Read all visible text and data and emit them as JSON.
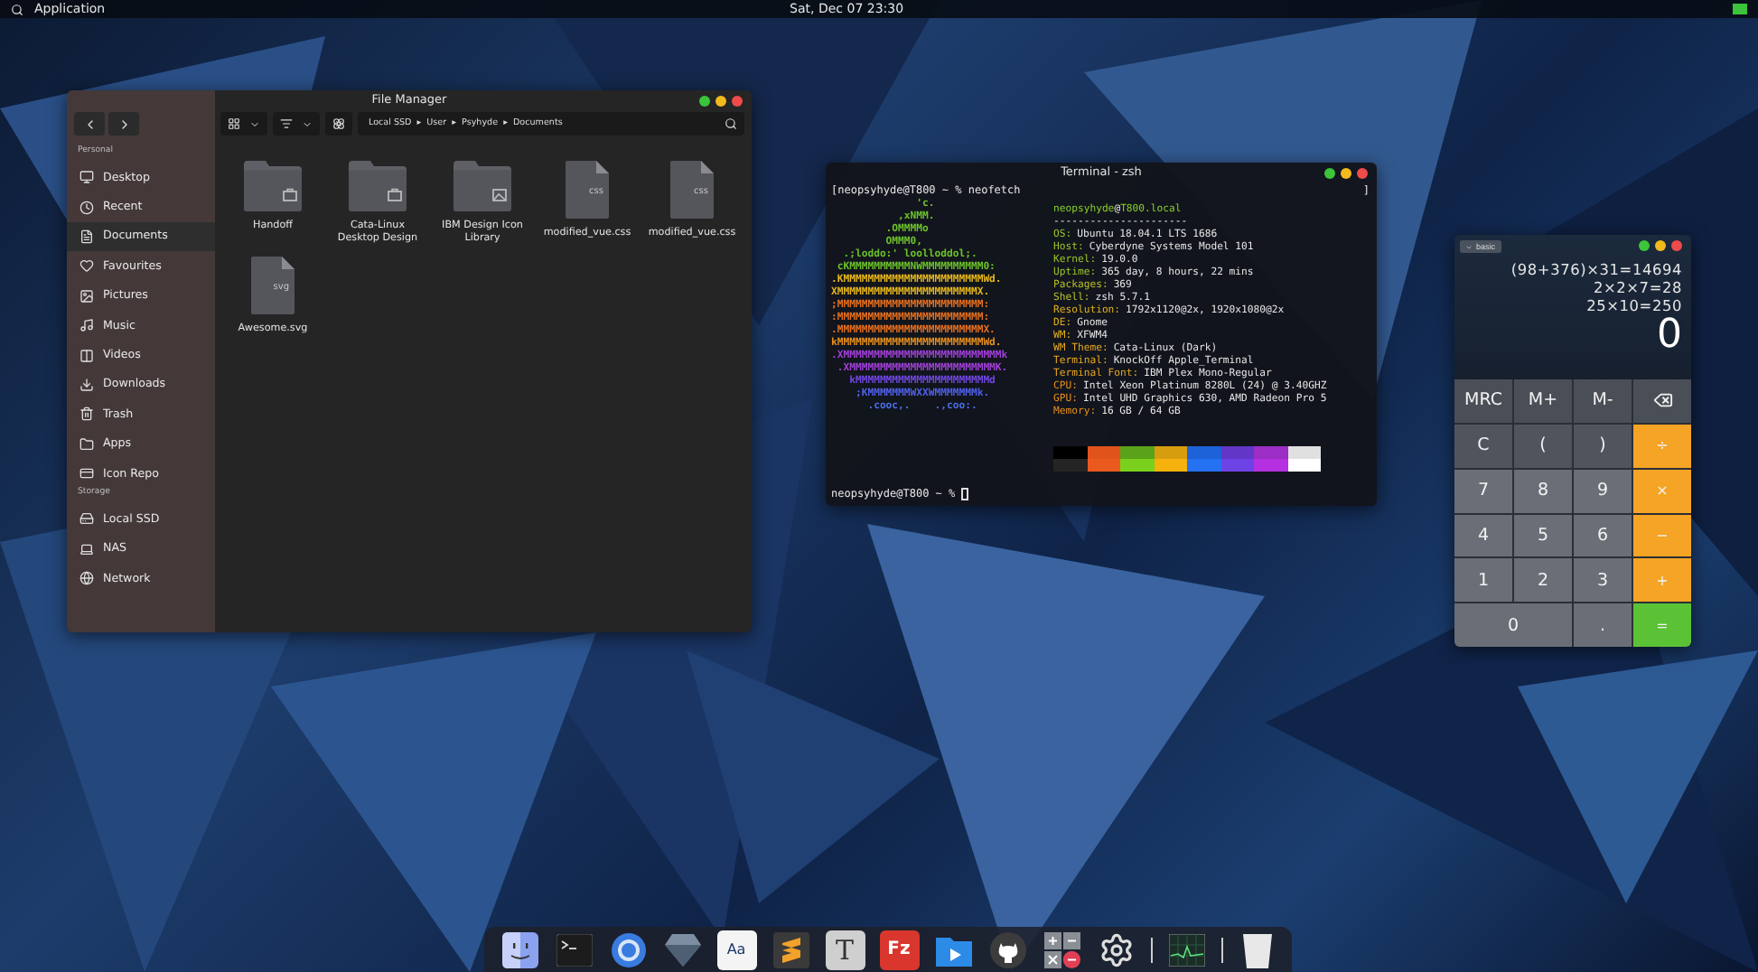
{
  "top_bar": {
    "menu": "Application",
    "clock": "Sat, Dec 07  23:30"
  },
  "file_manager": {
    "title": "File Manager",
    "sections": [
      {
        "label": "Personal",
        "items": [
          {
            "label": "Desktop",
            "kind": "desktop",
            "selected": false
          },
          {
            "label": "Recent",
            "kind": "recent",
            "selected": false
          },
          {
            "label": "Documents",
            "kind": "documents",
            "selected": true
          },
          {
            "label": "Favourites",
            "kind": "favourites",
            "selected": false
          },
          {
            "label": "Pictures",
            "kind": "pictures",
            "selected": false
          },
          {
            "label": "Music",
            "kind": "music",
            "selected": false
          },
          {
            "label": "Videos",
            "kind": "videos",
            "selected": false
          },
          {
            "label": "Downloads",
            "kind": "downloads",
            "selected": false
          },
          {
            "label": "Trash",
            "kind": "trash",
            "selected": false
          },
          {
            "label": "Apps",
            "kind": "apps",
            "selected": false
          },
          {
            "label": "Icon Repo",
            "kind": "repo",
            "selected": false
          }
        ]
      },
      {
        "label": "Storage",
        "items": [
          {
            "label": "Local SSD",
            "kind": "disk",
            "selected": false
          },
          {
            "label": "NAS",
            "kind": "nas",
            "selected": false
          },
          {
            "label": "Network",
            "kind": "network",
            "selected": false
          }
        ]
      }
    ],
    "path": {
      "crumbs": [
        "Local SSD",
        "User",
        "Psyhyde",
        "Documents"
      ],
      "separator": "▸"
    },
    "files": [
      {
        "name": "Handoff",
        "kind": "work-folder"
      },
      {
        "name": "Cata-Linux Desktop Design",
        "kind": "work-folder"
      },
      {
        "name": "IBM Design Icon Library",
        "kind": "image-folder"
      },
      {
        "name": "modified_vue.css",
        "kind": "file",
        "type_label": "css"
      },
      {
        "name": "modified_vue.css",
        "kind": "file",
        "type_label": "css"
      },
      {
        "name": "Awesome.svg",
        "kind": "file",
        "type_label": "svg"
      }
    ]
  },
  "terminal": {
    "title": "Terminal - zsh",
    "command": "[neopsyhyde@T800 ~ % neofetch",
    "right_mark": "]",
    "logo_lines": [
      {
        "text": "              'c.",
        "color": "#6cc22a"
      },
      {
        "text": "           ,xNMM.",
        "color": "#6cc22a"
      },
      {
        "text": "         .OMMMMo",
        "color": "#6cc22a"
      },
      {
        "text": "         OMMM0,",
        "color": "#6cc22a"
      },
      {
        "text": "  .;loddo:' loolloddol;.",
        "color": "#6cc22a"
      },
      {
        "text": " cKMMMMMMMMMMNWMMMMMMMMMM0:",
        "color": "#6cc22a"
      },
      {
        "text": ".KMMMMMMMMMMMMMMMMMMMMMMMWd.",
        "color": "#e8b81b"
      },
      {
        "text": "XMMMMMMMMMMMMMMMMMMMMMMMX.",
        "color": "#e8b81b"
      },
      {
        "text": ";MMMMMMMMMMMMMMMMMMMMMMMM:",
        "color": "#e8701e"
      },
      {
        "text": ":MMMMMMMMMMMMMMMMMMMMMMMM:",
        "color": "#e8701e"
      },
      {
        "text": ".MMMMMMMMMMMMMMMMMMMMMMMMX.",
        "color": "#e8701e"
      },
      {
        "text": "kMMMMMMMMMMMMMMMMMMMMMMMMWd.",
        "color": "#e8901e"
      },
      {
        "text": ".XMMMMMMMMMMMMMMMMMMMMMMMMMMk",
        "color": "#a040d8"
      },
      {
        "text": " .XMMMMMMMMMMMMMMMMMMMMMMMMK.",
        "color": "#a040d8"
      },
      {
        "text": "   kMMMMMMMMMMMMMMMMMMMMMMd",
        "color": "#7048e0"
      },
      {
        "text": "    ;KMMMMMMMWXXWMMMMMMMk.",
        "color": "#5060e8"
      },
      {
        "text": "      .cooc,.    .,coo:.",
        "color": "#4870e8"
      }
    ],
    "user": "neopsyhyde",
    "at": "@",
    "host": "T800.local",
    "rule": "----------------------",
    "info": [
      {
        "key": "OS:",
        "value": "Ubuntu 18.04.1 LTS 1686",
        "color": "#9cc62a"
      },
      {
        "key": "Host:",
        "value": "Cyberdyne Systems Model 101",
        "color": "#9cc62a"
      },
      {
        "key": "Kernel:",
        "value": "19.0.0",
        "color": "#9cc62a"
      },
      {
        "key": "Uptime:",
        "value": "365 day, 8 hours, 22 mins",
        "color": "#9cc62a"
      },
      {
        "key": "Packages:",
        "value": "369",
        "color": "#b8c026"
      },
      {
        "key": "Shell:",
        "value": "zsh 5.7.1",
        "color": "#b8c026"
      },
      {
        "key": "Resolution:",
        "value": "1792x1120@2x, 1920x1080@2x",
        "color": "#e2b21a"
      },
      {
        "key": "DE:",
        "value": "Gnome",
        "color": "#e2b21a"
      },
      {
        "key": "WM:",
        "value": "XFWM4",
        "color": "#e2b21a"
      },
      {
        "key": "WM Theme:",
        "value": "Cata-Linux (Dark)",
        "color": "#e8a81f"
      },
      {
        "key": "Terminal:",
        "value": "KnockOff Apple_Terminal",
        "color": "#e8a81f"
      },
      {
        "key": "Terminal Font:",
        "value": "IBM Plex Mono-Regular",
        "color": "#e8a81f"
      },
      {
        "key": "CPU:",
        "value": "Intel Xeon Platinum 8280L (24) @ 3.40GHZ",
        "color": "#e8901c"
      },
      {
        "key": "GPU:",
        "value": "Intel UHD Graphics 630, AMD Radeon Pro 5",
        "color": "#e8901c"
      },
      {
        "key": "Memory:",
        "value": "16 GB / 64 GB",
        "color": "#e8901c"
      }
    ],
    "palette": [
      {
        "color": "#000000"
      },
      {
        "color": "#e0541c"
      },
      {
        "color": "#5aa21a"
      },
      {
        "color": "#d69d0e"
      },
      {
        "color": "#1d62d9"
      },
      {
        "color": "#6236c6"
      },
      {
        "color": "#9c2ec5"
      },
      {
        "color": "#e0e0e0"
      },
      {
        "color": "#242424"
      },
      {
        "color": "#ea5a1f"
      },
      {
        "color": "#79d11d"
      },
      {
        "color": "#f5b20c"
      },
      {
        "color": "#2471f2"
      },
      {
        "color": "#6e43e5"
      },
      {
        "color": "#b530e0"
      },
      {
        "color": "#ffffff"
      }
    ],
    "prompt": "neopsyhyde@T800 ~ %"
  },
  "calculator": {
    "mode": "basic",
    "history": [
      "(98+376)×31=14694",
      "2×2×7=28",
      "25×10=250"
    ],
    "display": "0",
    "keys": [
      {
        "label": "MRC",
        "kind": "memory"
      },
      {
        "label": "M+",
        "kind": "memory"
      },
      {
        "label": "M-",
        "kind": "memory"
      },
      {
        "kind": "backspace"
      },
      {
        "label": "C",
        "kind": "function"
      },
      {
        "label": "(",
        "kind": "function"
      },
      {
        "label": ")",
        "kind": "function"
      },
      {
        "label": "÷",
        "kind": "operator"
      },
      {
        "label": "7",
        "kind": "digit"
      },
      {
        "label": "8",
        "kind": "digit"
      },
      {
        "label": "9",
        "kind": "digit"
      },
      {
        "label": "×",
        "kind": "operator"
      },
      {
        "label": "4",
        "kind": "digit"
      },
      {
        "label": "5",
        "kind": "digit"
      },
      {
        "label": "6",
        "kind": "digit"
      },
      {
        "label": "−",
        "kind": "operator"
      },
      {
        "label": "1",
        "kind": "digit"
      },
      {
        "label": "2",
        "kind": "digit"
      },
      {
        "label": "3",
        "kind": "digit"
      },
      {
        "label": "+",
        "kind": "operator"
      },
      {
        "label": "0",
        "kind": "wide-digit"
      },
      {
        "label": ".",
        "kind": "digit"
      },
      {
        "label": "=",
        "kind": "equals"
      }
    ]
  },
  "dock": {
    "items": [
      {
        "kind": "finder"
      },
      {
        "kind": "terminal"
      },
      {
        "kind": "browser"
      },
      {
        "kind": "gem"
      },
      {
        "kind": "glyph",
        "glyph": "Aa"
      },
      {
        "kind": "editor"
      },
      {
        "kind": "glyph-serif",
        "glyph": "T"
      },
      {
        "kind": "glyph-red",
        "glyph": "Fz"
      },
      {
        "kind": "video"
      },
      {
        "kind": "cat"
      },
      {
        "kind": "calculator"
      },
      {
        "kind": "settings"
      },
      {
        "kind": "separator"
      },
      {
        "kind": "monitor"
      },
      {
        "kind": "separator"
      },
      {
        "kind": "trash"
      }
    ]
  }
}
